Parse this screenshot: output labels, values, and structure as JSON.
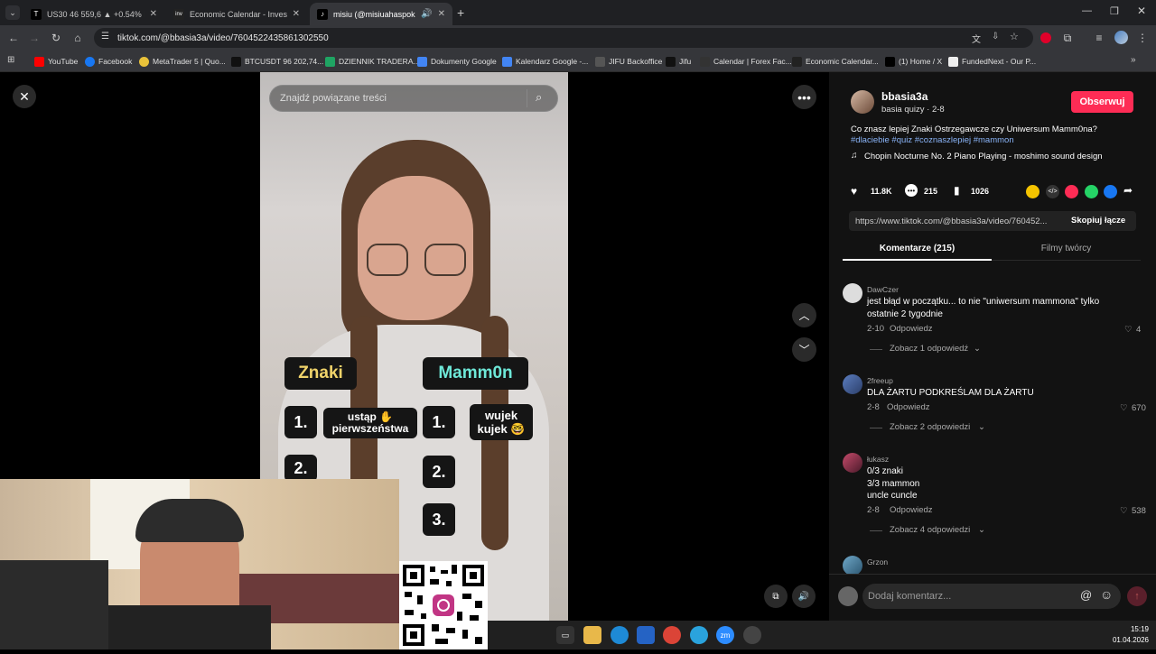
{
  "tabs": [
    {
      "title": "US30 46 559,6 ▲ +0.54% Bez n",
      "icon": "tradingview-icon",
      "active": false
    },
    {
      "title": "Economic Calendar - Investing.",
      "icon": "investing-icon",
      "active": false
    },
    {
      "title": "misiu (@misiuahaspoko) | T",
      "icon": "tiktok-icon",
      "active": true
    }
  ],
  "address": {
    "url": "tiktok.com/@bbasia3a/video/7604522435861302550"
  },
  "bookmarks": [
    "YouTube",
    "Facebook",
    "MetaTrader 5 | Quo...",
    "BTCUSDT 96 202,74...",
    "DZIENNIK TRADERA...",
    "Dokumenty Google",
    "Kalendarz Google -...",
    "JIFU Backoffice",
    "Jifu",
    "Calendar | Forex Fac...",
    "Economic Calendar...",
    "(1) Home / X",
    "FundedNext - Our P..."
  ],
  "video": {
    "search_placeholder": "Znajdź powiązane treści",
    "col_left": "Znaki",
    "col_right": "Mamm0n",
    "left_items": [
      "1.",
      "2."
    ],
    "left_answer": "ustąp ✋ pierwszeństwa",
    "right_items": [
      "1.",
      "2.",
      "3."
    ],
    "right_answer": "wujek kujek 🤓"
  },
  "author": {
    "username": "bbasia3a",
    "subtitle": "basia quizy · 2-8",
    "follow_label": "Obserwuj"
  },
  "description": {
    "text": "Co znasz lepiej Znaki Ostrzegawcze czy Uniwersum Mamm0na?",
    "hashtags": "#dlaciebie #quiz #coznaszlepiej #mammon",
    "music": "Chopin Nocturne No. 2 Piano Playing - moshimo sound design"
  },
  "stats": {
    "likes": "11.8K",
    "comments": "215",
    "saves": "1026"
  },
  "link": {
    "url": "https://www.tiktok.com/@bbasia3a/video/760452...",
    "copy_label": "Skopiuj łącze"
  },
  "panel_tabs": {
    "comments": "Komentarze (215)",
    "creator_videos": "Filmy twórcy"
  },
  "comments": [
    {
      "user": "DawCzer",
      "text": "jest błąd w początku... to nie \"uniwersum mammona\" tylko ostatnie 2 tygodnie",
      "date": "2-10",
      "reply": "Odpowiedz",
      "likes": "4",
      "more": "Zobacz 1 odpowiedź"
    },
    {
      "user": "2freeup",
      "text": "DLA ŻARTU PODKREŚLAM DLA ŻARTU",
      "date": "2-8",
      "reply": "Odpowiedz",
      "likes": "670",
      "more": "Zobacz 2 odpowiedzi"
    },
    {
      "user": "łukasz",
      "text": "0/3 znaki\n3/3 mammon\nuncle cuncle",
      "date": "2-8",
      "reply": "Odpowiedz",
      "likes": "538",
      "more": "Zobacz 4 odpowiedzi"
    },
    {
      "user": "Grzon",
      "text": "",
      "date": "",
      "reply": "",
      "likes": "",
      "more": ""
    }
  ],
  "comment_input": {
    "placeholder": "Dodaj komentarz..."
  },
  "taskbar": {
    "time": "15:19",
    "date": "01.04.2026"
  }
}
